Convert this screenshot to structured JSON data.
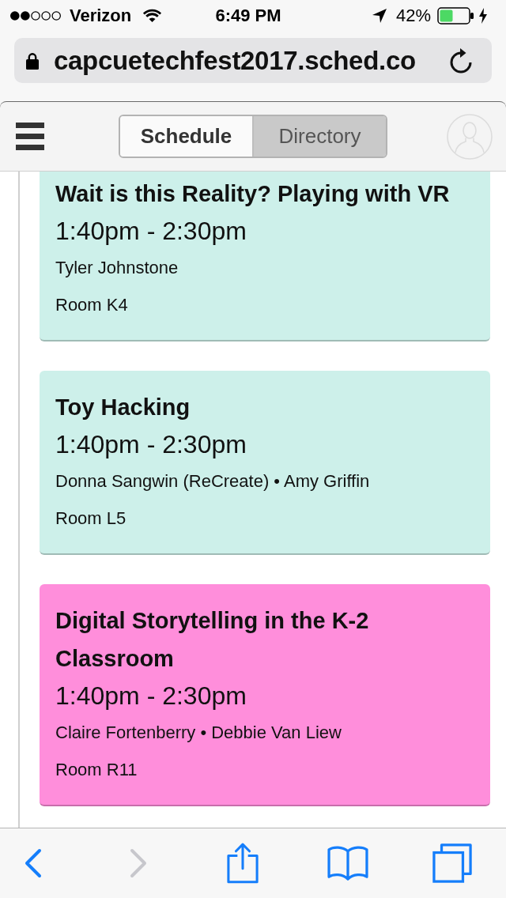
{
  "status_bar": {
    "carrier": "Verizon",
    "time": "6:49 PM",
    "battery": "42%"
  },
  "browser": {
    "url": "capcuetechfest2017.sched.co"
  },
  "header": {
    "tabs": [
      {
        "label": "Schedule",
        "selected": true
      },
      {
        "label": "Directory",
        "selected": false
      }
    ]
  },
  "sessions": [
    {
      "title": "Wait is this Reality? Playing with VR",
      "time": "1:40pm - 2:30pm",
      "speakers": "Tyler Johnstone",
      "room": "Room K4",
      "color": "#cdf0ea"
    },
    {
      "title": "Toy Hacking",
      "time": "1:40pm - 2:30pm",
      "speakers": "Donna Sangwin (ReCreate) • Amy Griffin",
      "room": "Room L5",
      "color": "#cdf0ea"
    },
    {
      "title": "Digital Storytelling in the K-2 Classroom",
      "time": "1:40pm - 2:30pm",
      "speakers": "Claire Fortenberry • Debbie Van Liew",
      "room": "Room R11",
      "color": "#ff8edb"
    }
  ],
  "toolbar": {
    "buttons": [
      {
        "kind": "back",
        "disabled": false
      },
      {
        "kind": "forward",
        "disabled": true
      },
      {
        "kind": "share",
        "disabled": false
      },
      {
        "kind": "bookmarks",
        "disabled": false
      },
      {
        "kind": "tabs",
        "disabled": false
      }
    ]
  }
}
